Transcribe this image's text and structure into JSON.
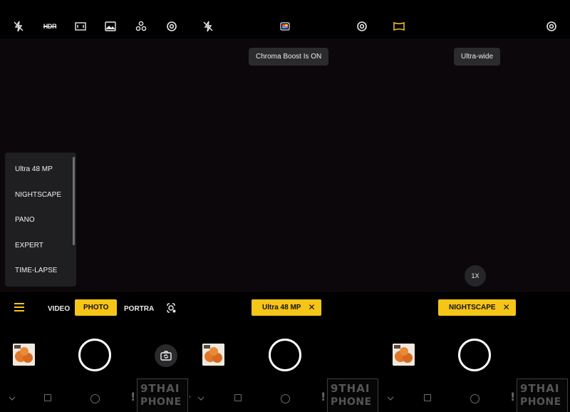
{
  "panel1": {
    "top_icons": [
      "flash-off-icon",
      "hdr-icon",
      "ratio-icon",
      "filter-icon",
      "ai-scene-icon",
      "settings-icon"
    ],
    "hdr_label": "HDR",
    "more_modes": [
      "Ultra 48 MP",
      "NIGHTSCAPE",
      "PANO",
      "EXPERT",
      "TIME-LAPSE"
    ],
    "tabs": {
      "video": "VIDEO",
      "photo": "PHOTO",
      "portrait": "PORTRAIT"
    },
    "active_tab": "photo"
  },
  "panel2": {
    "top_icons": [
      "flash-off-icon",
      "chroma-boost-icon",
      "settings-icon"
    ],
    "toast": "Chroma Boost Is ON",
    "mode_chip": "Ultra 48 MP",
    "chip_close": "✕"
  },
  "panel3": {
    "top_icons": [
      "ultra-wide-icon",
      "settings-icon"
    ],
    "toast": "Ultra-wide",
    "zoom_label": "1X",
    "mode_chip": "NIGHTSCAPE",
    "chip_close": "✕"
  },
  "watermark": {
    "line1": "9THAI",
    "line2": "PHONE"
  },
  "colors": {
    "accent": "#f5c518",
    "background": "#000000",
    "viewfinder": "#0b070b",
    "surface": "#1f1f21"
  }
}
